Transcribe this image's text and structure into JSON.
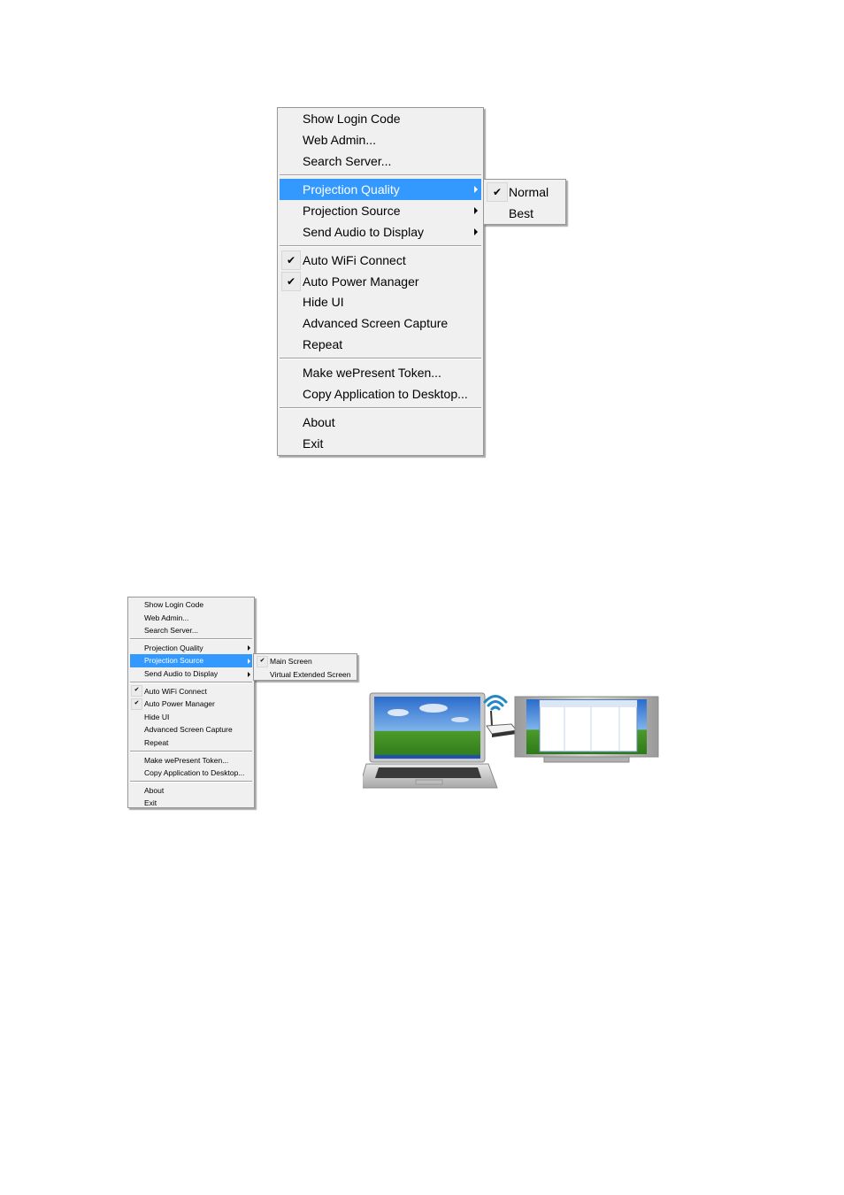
{
  "figure1": {
    "menu": {
      "groups": [
        [
          {
            "label": "Show Login Code"
          },
          {
            "label": "Web Admin..."
          },
          {
            "label": "Search Server..."
          }
        ],
        [
          {
            "label": "Projection Quality",
            "submenu": true,
            "highlighted": true
          },
          {
            "label": "Projection Source",
            "submenu": true
          },
          {
            "label": "Send Audio to Display",
            "submenu": true
          }
        ],
        [
          {
            "label": "Auto WiFi Connect",
            "checked": true
          },
          {
            "label": "Auto Power Manager",
            "checked": true
          },
          {
            "label": "Hide UI"
          },
          {
            "label": "Advanced Screen Capture"
          },
          {
            "label": "Repeat"
          }
        ],
        [
          {
            "label": "Make wePresent Token..."
          },
          {
            "label": "Copy Application to Desktop..."
          }
        ],
        [
          {
            "label": "About"
          },
          {
            "label": "Exit"
          }
        ]
      ]
    },
    "submenu": {
      "parent": "Projection Quality",
      "items": [
        {
          "label": "Normal",
          "checked": true
        },
        {
          "label": "Best"
        }
      ]
    }
  },
  "figure2": {
    "menu": {
      "groups": [
        [
          {
            "label": "Show Login Code"
          },
          {
            "label": "Web Admin..."
          },
          {
            "label": "Search Server..."
          }
        ],
        [
          {
            "label": "Projection Quality",
            "submenu": true
          },
          {
            "label": "Projection Source",
            "submenu": true,
            "highlighted": true
          },
          {
            "label": "Send Audio to Display",
            "submenu": true
          }
        ],
        [
          {
            "label": "Auto WiFi Connect",
            "checked": true
          },
          {
            "label": "Auto Power Manager",
            "checked": true
          },
          {
            "label": "Hide UI"
          },
          {
            "label": "Advanced Screen Capture"
          },
          {
            "label": "Repeat"
          }
        ],
        [
          {
            "label": "Make wePresent Token..."
          },
          {
            "label": "Copy Application to Desktop..."
          }
        ],
        [
          {
            "label": "About"
          },
          {
            "label": "Exit"
          }
        ]
      ]
    },
    "submenu": {
      "parent": "Projection Source",
      "items": [
        {
          "label": "Main Screen",
          "checked": true
        },
        {
          "label": "Virtual Extended Screen"
        }
      ]
    },
    "illustration": {
      "description": "Laptop wirelessly projecting to external display via wePresent receiver",
      "icons": [
        "laptop-icon",
        "wifi-signal-icon",
        "wireless-receiver-icon",
        "display-monitor-icon"
      ]
    }
  },
  "colors": {
    "menu_bg": "#f0f0f0",
    "highlight": "#3399ff",
    "highlight_text": "#ffffff",
    "border": "#979797"
  },
  "icons": {
    "check": "✔"
  }
}
